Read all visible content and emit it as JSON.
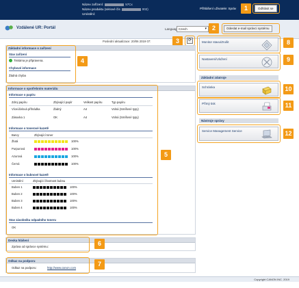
{
  "header": {
    "device_name_label": "Název zařízení:",
    "device_name_value_suffix": "57Cx",
    "product_name_label": "Název produktu (sériové čís",
    "product_name_value_suffix": "002)",
    "location_label": "Umístění:",
    "login_user_label": "Přihlášení uživatele: Správ",
    "logout_label": "Odhlásit se"
  },
  "portal": {
    "title": "Vzdálené UR: Portál",
    "language_label": "Language:",
    "language_value": "Czech",
    "email_button": "Odeslat e-mail správci systému",
    "last_update": "Poslední aktualizace: 20/06 2019 07:"
  },
  "device_info": {
    "title": "Základní informace o zařízení",
    "status_heading": "Stav zařízení",
    "status_ready": "Tiskárna je připravena.",
    "error_heading": "Chybové informace",
    "error_value": "Žádná chyba",
    "status_dot_color": "#2fae3a"
  },
  "consumables": {
    "title": "Informace o spotřebním materiálu",
    "paper": {
      "title": "Informace o papíru",
      "headers": [
        "Zdroj papíru",
        "Zbývající papír",
        "Velikost papíru",
        "Typ papíru"
      ],
      "rows": [
        [
          "Víceúčelová přihrádka",
          "Žádný",
          "A4",
          "Volná (Smíšené typy)"
        ],
        [
          "Zásuvka 1",
          "OK",
          "A4",
          "Volná (Smíšené typy)"
        ]
      ]
    },
    "toner": {
      "title": "Informace o tonerové kazetě",
      "headers": [
        "Barvy",
        "Zbývající toner"
      ],
      "rows": [
        {
          "name": "Žlutá",
          "color": "#f2e51b",
          "percent": "100%",
          "level": 1.0
        },
        {
          "name": "Purpurová",
          "color": "#e11f8f",
          "percent": "100%",
          "level": 1.0
        },
        {
          "name": "Azurová",
          "color": "#1aa6e0",
          "percent": "100%",
          "level": 1.0
        },
        {
          "name": "Černá",
          "color": "#111111",
          "percent": "100%",
          "level": 1.0
        }
      ]
    },
    "drum": {
      "title": "Informace o bubnové kazetě",
      "headers": [
        "Umístění",
        "Zbývající životnost bubnu"
      ],
      "rows": [
        {
          "name": "Buben 1",
          "percent": "100%",
          "level": 1.0
        },
        {
          "name": "Buben 2",
          "percent": "100%",
          "level": 1.0
        },
        {
          "name": "Buben 3",
          "percent": "100%",
          "level": 1.0
        },
        {
          "name": "Buben 4",
          "percent": "100%",
          "level": 1.0
        }
      ]
    },
    "waste": {
      "title": "Stav zásobníku odpadního toneru",
      "value": "OK"
    }
  },
  "message_board": {
    "title": "Deska hlášení",
    "text": "Zpráva od správce systému:"
  },
  "support": {
    "title": "Odkaz na podporu",
    "label": "Odkaz na podporu:",
    "url": "http://www.canon.com"
  },
  "right": {
    "monitor_button": "Monitor stavu/Zrušit",
    "settings_button": "Nastavení/Uložení",
    "basic_section": "Základní zdatroje",
    "mailbox_button": "Schránka",
    "direct_print_button": "Přímý tisk",
    "admin_section": "Nástroje správy",
    "sms_button": "Service Management Service"
  },
  "badges": [
    "1",
    "2",
    "3",
    "4",
    "5",
    "6",
    "7",
    "8",
    "9",
    "10",
    "11",
    "12"
  ],
  "footer": {
    "copyright": "Copyright CANON INC. 2019"
  },
  "colors": {
    "header_bg": "#0a2b5a",
    "accent": "#f39a16",
    "heading": "#1b3b6a"
  }
}
